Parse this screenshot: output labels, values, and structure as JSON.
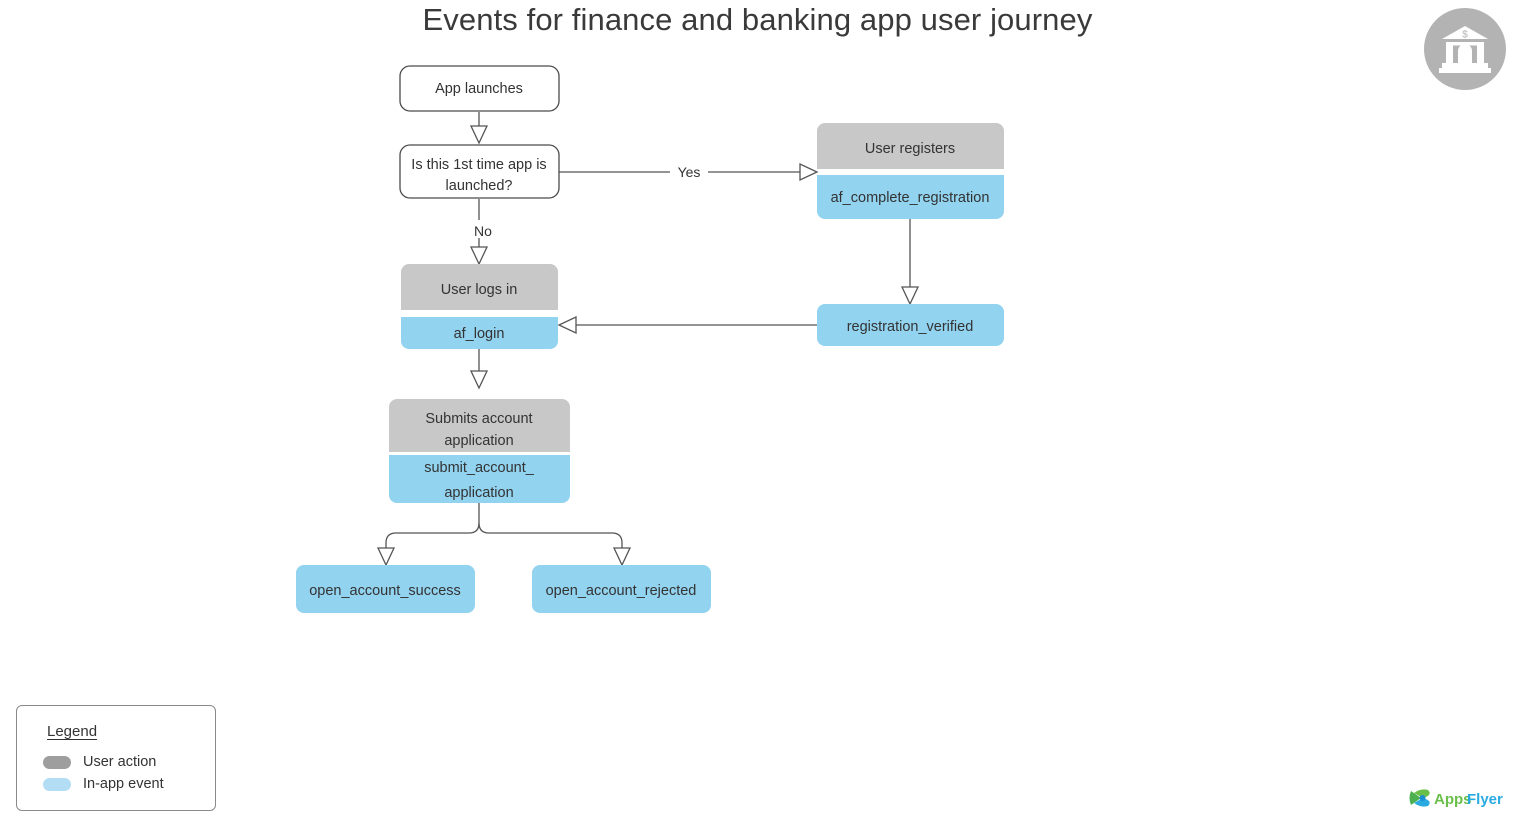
{
  "title": "Events for finance and banking app user journey",
  "brand": {
    "logo_text_1": "Apps",
    "logo_text_2": "Flyer",
    "logo_name": "appsflyer-logo",
    "badge_icon": "bank-icon",
    "badge_currency": "$"
  },
  "colors": {
    "user_action": "#c8c8c8",
    "in_app_event": "#92d3f0",
    "legend_user_action": "#9e9e9e",
    "legend_in_app_event": "#b3ddf5",
    "text": "#333333",
    "connector": "#555555",
    "box_border": "#4a4a4a"
  },
  "nodes": {
    "app_launches": "App launches",
    "decision": "Is this 1st time app is launched?",
    "decision_line1": "Is this 1st time app is",
    "decision_line2": "launched?",
    "user_registers": "User registers",
    "af_complete_registration": "af_complete_registration",
    "registration_verified": "registration_verified",
    "user_logs_in": "User logs in",
    "af_login": "af_login",
    "submits_account_application_line1": "Submits account",
    "submits_account_application_line2": "application",
    "submit_account_application_line1": "submit_account_",
    "submit_account_application_line2": "application",
    "open_account_success": "open_account_success",
    "open_account_rejected": "open_account_rejected"
  },
  "edges": {
    "yes": "Yes",
    "no": "No"
  },
  "legend": {
    "title": "Legend",
    "items": [
      {
        "label": "User action",
        "color": "#9e9e9e"
      },
      {
        "label": "In-app event",
        "color": "#b3ddf5"
      }
    ]
  }
}
